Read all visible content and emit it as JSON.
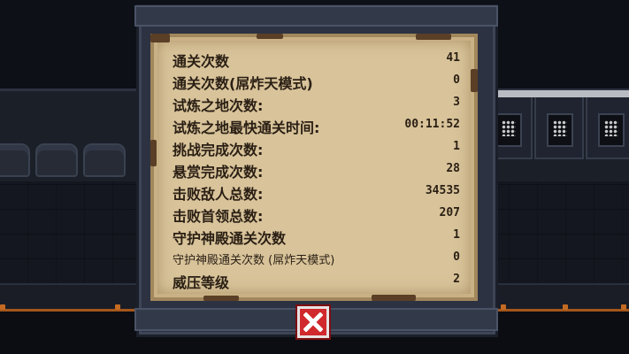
{
  "stats_panel": {
    "rows": [
      {
        "label": "通关次数",
        "value": "41"
      },
      {
        "label": "通关次数(屌炸天模式)",
        "value": "0"
      },
      {
        "label": "试炼之地次数:",
        "value": "3"
      },
      {
        "label": "试炼之地最快通关时间:",
        "value": "00:11:52"
      },
      {
        "label": "挑战完成次数:",
        "value": "1"
      },
      {
        "label": "悬赏完成次数:",
        "value": "28"
      },
      {
        "label": "击败敌人总数:",
        "value": "34535"
      },
      {
        "label": "击败首领总数:",
        "value": "207"
      },
      {
        "label": "守护神殿通关次数",
        "value": "1"
      },
      {
        "label": "守护神殿通关次数 (屌炸天模式)",
        "value": "0"
      },
      {
        "label": "威压等级",
        "value": "2"
      }
    ]
  },
  "close_button": {
    "icon": "close-x-icon",
    "color": "#d0282c"
  },
  "colors": {
    "parchment": "#d8c39a",
    "text": "#2a1f14",
    "frame": "#2c3241",
    "rail_glow": "#a4561a"
  }
}
